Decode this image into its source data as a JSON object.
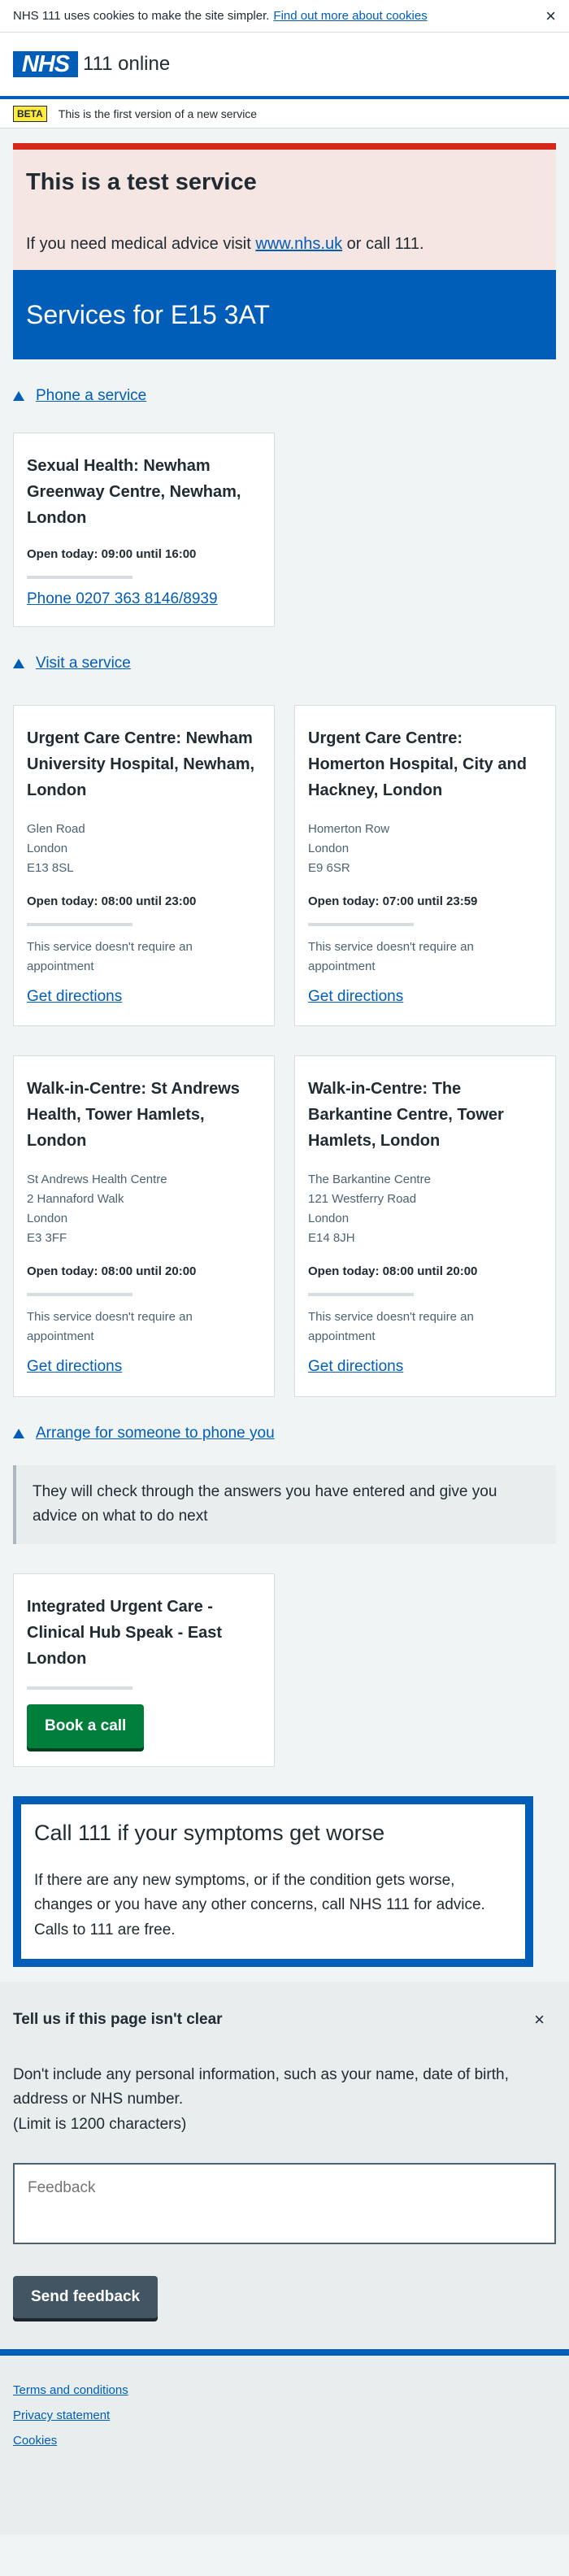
{
  "cookie_banner": {
    "text": "NHS 111 uses cookies to make the site simpler.",
    "link": "Find out more about cookies",
    "close": "×"
  },
  "header": {
    "logo": "NHS",
    "service_name": "111 online"
  },
  "beta": {
    "tag": "BETA",
    "text": "This is the first version of a new service"
  },
  "test_notice": {
    "title": "This is a test service",
    "text_before": "If you need medical advice visit",
    "link": "www.nhs.uk",
    "text_after": "or call 111."
  },
  "page_title": "Services for E15 3AT",
  "phone_section": {
    "link": "Phone a service",
    "card": {
      "name": "Sexual Health: Newham Greenway Centre, Newham, London",
      "open": "Open today: 09:00 until 16:00",
      "phone": "Phone 0207 363 8146/8939"
    }
  },
  "visit_section": {
    "link": "Visit a service",
    "cards": [
      {
        "name": "Urgent Care Centre: Newham University Hospital, Newham, London",
        "address": [
          "Glen Road",
          "London",
          "E13 8SL"
        ],
        "open": "Open today: 08:00 until 23:00",
        "note": "This service doesn't require an appointment",
        "directions": "Get directions"
      },
      {
        "name": "Urgent Care Centre: Homerton Hospital, City and Hackney, London",
        "address": [
          "Homerton Row",
          "London",
          "E9 6SR"
        ],
        "open": "Open today: 07:00 until 23:59",
        "note": "This service doesn't require an appointment",
        "directions": "Get directions"
      },
      {
        "name": "Walk-in-Centre: St Andrews Health, Tower Hamlets, London",
        "address": [
          "St Andrews Health Centre",
          "2 Hannaford Walk",
          "London",
          "E3 3FF"
        ],
        "open": "Open today: 08:00 until 20:00",
        "note": "This service doesn't require an appointment",
        "directions": "Get directions"
      },
      {
        "name": "Walk-in-Centre: The Barkantine Centre, Tower Hamlets, London",
        "address": [
          "The Barkantine Centre",
          "121 Westferry Road",
          "London",
          "E14 8JH"
        ],
        "open": "Open today: 08:00 until 20:00",
        "note": "This service doesn't require an appointment",
        "directions": "Get directions"
      }
    ]
  },
  "callback_section": {
    "link": "Arrange for someone to phone you",
    "inset": "They will check through the answers you have entered and give you advice on what to do next",
    "card": {
      "name": "Integrated Urgent Care - Clinical Hub Speak - East London",
      "button": "Book a call"
    }
  },
  "care_card": {
    "title": "Call 111 if your symptoms get worse",
    "text": "If there are any new symptoms, or if the condition gets worse, changes or you have any other concerns, call NHS 111 for advice. Calls to 111 are free."
  },
  "feedback": {
    "title": "Tell us if this page isn't clear",
    "close": "×",
    "text": "Don't include any personal information, such as your name, date of birth, address or NHS number.",
    "limit": "(Limit is 1200 characters)",
    "placeholder": "Feedback",
    "button": "Send feedback"
  },
  "footer": {
    "links": [
      "Terms and conditions",
      "Privacy statement",
      "Cookies"
    ]
  },
  "colors": {
    "nhs_blue": "#005eb8",
    "green": "#007f3b",
    "red": "#d5281b",
    "beta_yellow": "#ffeb3b"
  }
}
